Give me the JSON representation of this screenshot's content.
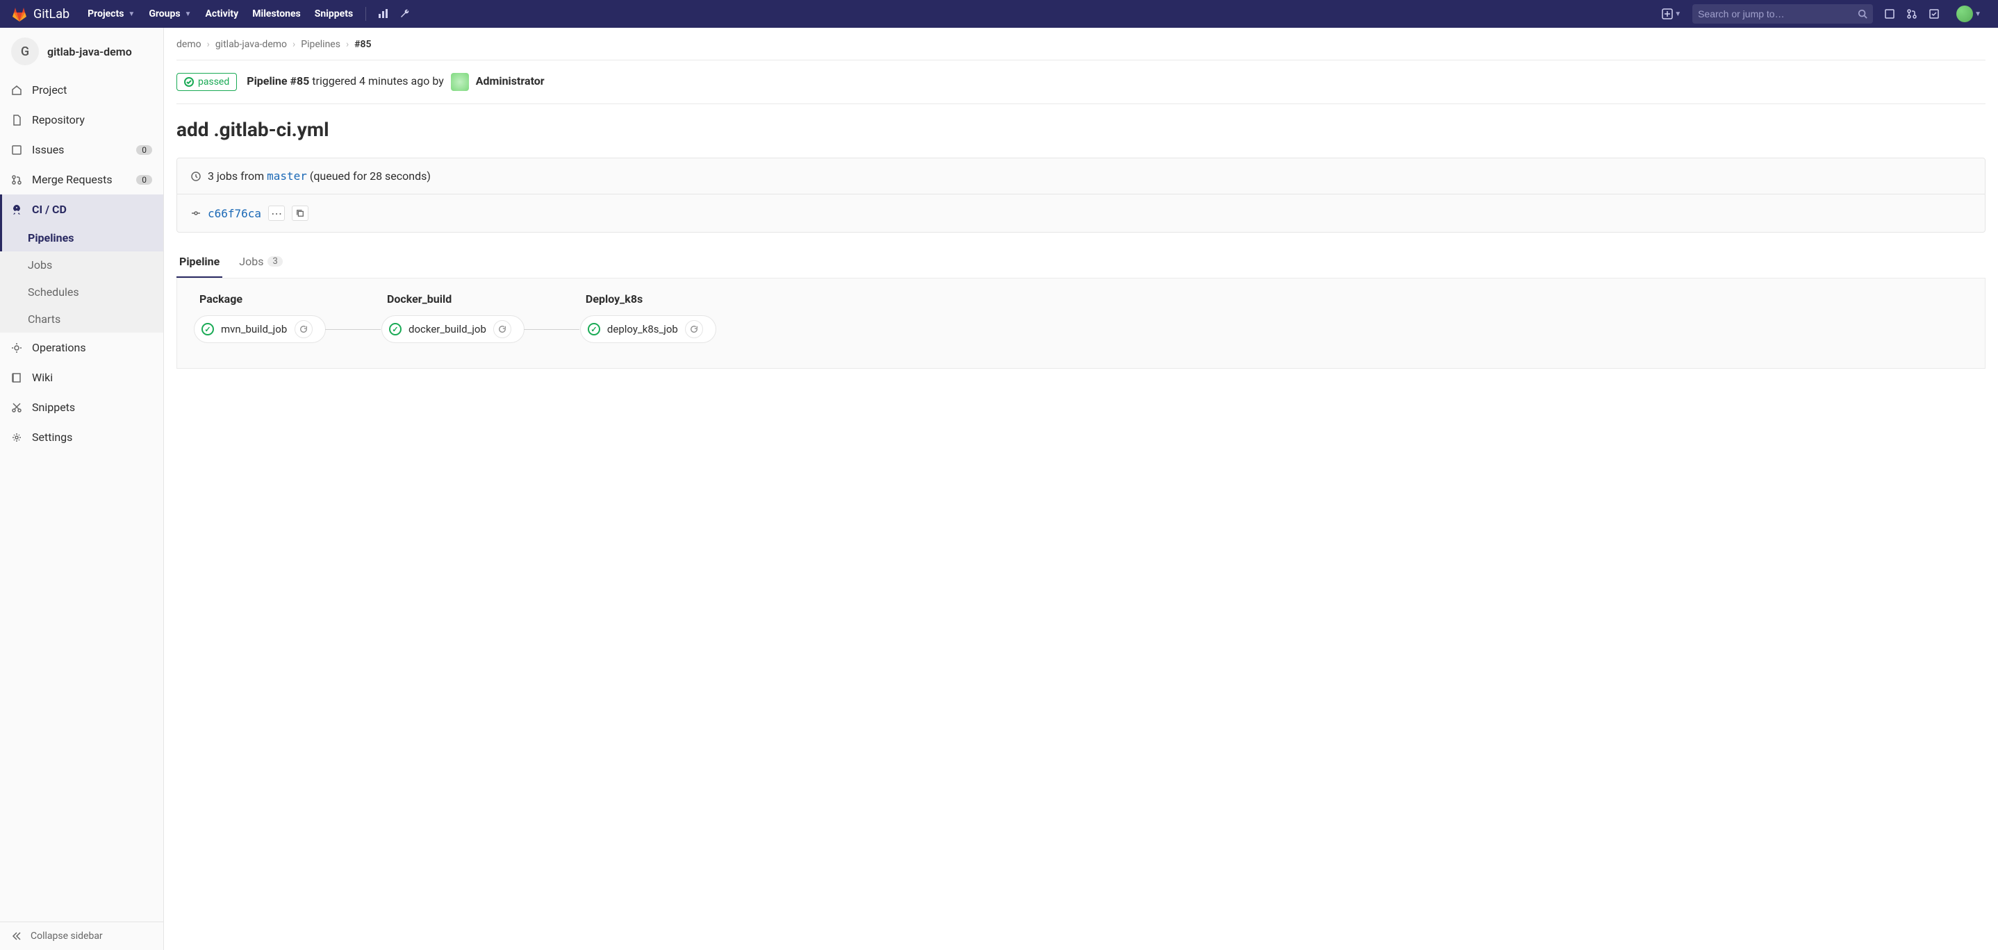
{
  "brand": "GitLab",
  "topnav": {
    "projects": "Projects",
    "groups": "Groups",
    "activity": "Activity",
    "milestones": "Milestones",
    "snippets": "Snippets",
    "search_placeholder": "Search or jump to…"
  },
  "project": {
    "avatar_letter": "G",
    "name": "gitlab-java-demo"
  },
  "sidebar": {
    "project": "Project",
    "repository": "Repository",
    "issues": "Issues",
    "issues_count": "0",
    "merge_requests": "Merge Requests",
    "mr_count": "0",
    "cicd": "CI / CD",
    "pipelines": "Pipelines",
    "jobs": "Jobs",
    "schedules": "Schedules",
    "charts": "Charts",
    "operations": "Operations",
    "wiki": "Wiki",
    "snippets": "Snippets",
    "settings": "Settings",
    "collapse": "Collapse sidebar"
  },
  "breadcrumb": {
    "c1": "demo",
    "c2": "gitlab-java-demo",
    "c3": "Pipelines",
    "c4": "#85"
  },
  "pipeline": {
    "status": "passed",
    "id_label": "Pipeline #85",
    "triggered_text": "triggered 4 minutes ago by",
    "user": "Administrator",
    "commit_title": "add .gitlab-ci.yml",
    "jobs_from_prefix": "3 jobs from ",
    "branch": "master",
    "queued_text": " (queued for 28 seconds)",
    "commit_sha": "c66f76ca"
  },
  "tabs": {
    "pipeline": "Pipeline",
    "jobs": "Jobs",
    "jobs_count": "3"
  },
  "stages": [
    {
      "name": "Package",
      "jobs": [
        {
          "name": "mvn_build_job",
          "status": "passed"
        }
      ]
    },
    {
      "name": "Docker_build",
      "jobs": [
        {
          "name": "docker_build_job",
          "status": "passed"
        }
      ]
    },
    {
      "name": "Deploy_k8s",
      "jobs": [
        {
          "name": "deploy_k8s_job",
          "status": "passed"
        }
      ]
    }
  ]
}
